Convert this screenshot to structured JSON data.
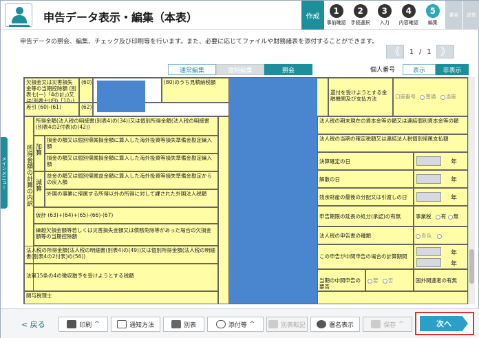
{
  "header": {
    "title": "申告データ表示・編集（本表）",
    "steps_start": "作成",
    "steps": [
      {
        "num": "1",
        "label": "事前確認"
      },
      {
        "num": "2",
        "label": "手続選択"
      },
      {
        "num": "3",
        "label": "入力"
      },
      {
        "num": "4",
        "label": "内容確認"
      },
      {
        "num": "5",
        "label": "編集"
      }
    ],
    "tail": [
      "署名",
      "送信"
    ]
  },
  "description": "申告データの照会、編集、チェック及び印刷等を行います。また、必要に応じてファイルや財務諸表を添付することができます。",
  "pager": {
    "prev": "《",
    "current": "1",
    "sep": "/",
    "total": "1",
    "next": "》"
  },
  "modes": {
    "normal": "通常編集",
    "force": "強制編集",
    "inquiry": "照会"
  },
  "kojin_label": "個人番号",
  "display": {
    "show": "表示",
    "hide": "非表示"
  },
  "side_tab": "メインメニュー",
  "form": {
    "r1a": "欠損金又は災害損失金等の当期控除額 (別表七(一)「4の計」)又は(別表七(四)「10」)",
    "r1a_no": "(60)",
    "r1b": "(80)のうち見積納税額",
    "r2a": "差引 (60)-(61)",
    "r2a_no": "(62)",
    "kanpu": "還付を受けようとする金融機関及び支払方法",
    "kouza": "口座番号",
    "futsu": "普通",
    "touza": "当座",
    "sidecol": "所得金額の計算の内訳",
    "kasan": "加算",
    "gensan": "減算",
    "s1": "所得金額(法人税の明細書(別表4)の(34))又は個別所得金額(法人税の明細書(別表4の2付表)の(42))",
    "s2": "損金の額又は個別帰属損金額に算入した海外投資等損失準備金勘定繰入額",
    "s3": "損金の額又は個別帰属損金額に算入した海外投資等損失準備金勘定繰入額",
    "s4": "益金の額又は個別帰属益金額に算入した海外投資等損失準備金勘定からの戻入額",
    "s5": "外国の事業に帰属する所得以外の所得に対して課された外国法人税額",
    "s6": "仮計 (63)+(64)+(65)-(66)-(67)",
    "s7": "繰越欠損金額等若しくは災害損失金額又は債務免除等があった場合の欠損金額等の当期控除額",
    "s8": "法人税の所得金額(法人税の明細書(別表4)の(49))又は個別所得金額(法人税の明細書(別表4の2付表)の(56))",
    "s9": "法第15条の4の徴収猶予を受けようとする税額",
    "s10": "関与税理士",
    "r_a": "法人税の期末現在の資本金等の額又は連結個別資本金等の額",
    "r_b": "法人税の当期の確定税額又は連結法人税個別帰属支払額",
    "r_c": "決算確定の日",
    "r_d": "解散の日",
    "r_e": "残余財産の最後の分配又は引渡しの日",
    "r_f": "申告期限の延長の処分(承認)の有無",
    "r_f2": "事業税",
    "r_f3": "有",
    "r_f4": "無",
    "r_g": "法人税の申告書の種類",
    "r_g2": "青色",
    "r_h": "この申告が中間申告の場合の計算期間",
    "r_i": "当期の中間申告の要否",
    "r_i2": "要",
    "r_i3": "否",
    "r_i4": "国外関連者の有無",
    "nen": "年"
  },
  "footer": {
    "back": "戻る",
    "print": "印刷",
    "notice": "通知方法",
    "beppyo": "別表",
    "attach": "添付等",
    "beppyo_tenki": "別表転記",
    "sign_view": "署名表示",
    "save": "保存",
    "next": "次へ"
  },
  "colors": {
    "accent": "#1c8f9a",
    "form_bg": "#fffea6",
    "mask": "#4a86d0",
    "next": "#2aa0c8",
    "highlight": "#e03030"
  }
}
